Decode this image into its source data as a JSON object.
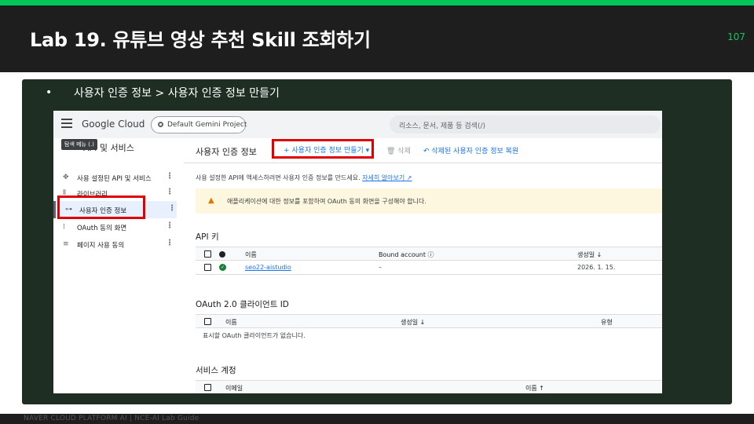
{
  "slide": {
    "title": "Lab 19. 유튜브 영상 추천 Skill 조회하기",
    "page_number": "107",
    "bullet": "•",
    "bullet_text": "사용자 인증 정보 > 사용자 인증 정보 만들기",
    "footer": "NAVER CLOUD PLATFORM AI  |  NCE-AI Lab Guide"
  },
  "console": {
    "logo": "Google Cloud",
    "project": "Default Gemini Project",
    "search_placeholder": "리소스, 문서, 제품 등 검색(/)",
    "tooltip": "탐색 메뉴 (.)",
    "sidebar": {
      "title": "API 및 서비스",
      "items": [
        {
          "icon": "✥",
          "label": "사용 설정된 API 및 서비스"
        },
        {
          "icon": "⦀",
          "label": "라이브러리"
        },
        {
          "icon": "⊶",
          "label": "사용자 인증 정보"
        },
        {
          "icon": "⁞",
          "label": "OAuth 동의 화면"
        },
        {
          "icon": "≡",
          "label": "페이지 사용 동의"
        }
      ],
      "more": "⋮"
    },
    "toolbar": {
      "page_title": "사용자 인증 정보",
      "create": "+ 사용자 인증 정보 만들기 ▾",
      "delete": "🗑 삭제",
      "restore": "↶ 삭제된 사용자 인증 정보 복원"
    },
    "description": "사용 설정한 API에 액세스하려면 사용자 인증 정보를 만드세요.",
    "learn_more": "자세히 알아보기 ↗",
    "warning_icon": "▲",
    "warning": "애플리케이션에 대한 정보를 포함하여 OAuth 동의 화면을 구성해야 합니다.",
    "api_keys": {
      "title": "API 키",
      "headers": [
        "이름",
        "Bound account ⓘ",
        "생성일 ↓"
      ],
      "rows": [
        {
          "name": "seo22-aistudio",
          "bound": "–",
          "created": "2026. 1. 15.",
          "status": "✓"
        }
      ]
    },
    "oauth": {
      "title": "OAuth 2.0 클라이언트 ID",
      "headers": [
        "이름",
        "생성일 ↓",
        "유형"
      ],
      "empty": "표시할 OAuth 클라이언트가 없습니다."
    },
    "service_accounts": {
      "title": "서비스 계정",
      "headers": [
        "이메일",
        "이름 ↑"
      ]
    }
  }
}
